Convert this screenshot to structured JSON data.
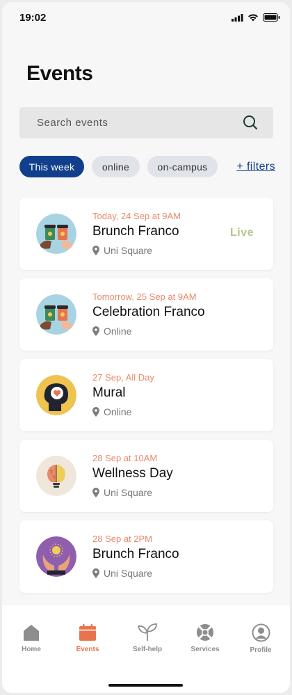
{
  "status": {
    "time": "19:02"
  },
  "page": {
    "title": "Events"
  },
  "search": {
    "placeholder": "Search events"
  },
  "filters": {
    "chips": [
      "This week",
      "online",
      "on-campus"
    ],
    "active": "This week",
    "more_label": "+ filters"
  },
  "events": [
    {
      "date": "Today, 24 Sep at 9AM",
      "name": "Brunch Franco",
      "location": "Uni Square",
      "badge": "Live",
      "icon": "coffee-cups-icon"
    },
    {
      "date": "Tomorrow, 25 Sep at 9AM",
      "name": "Celebration Franco",
      "location": "Online",
      "badge": "",
      "icon": "coffee-cups-icon"
    },
    {
      "date": "27 Sep, All Day",
      "name": "Mural",
      "location": "Online",
      "badge": "",
      "icon": "head-heart-icon"
    },
    {
      "date": "28 Sep at 10AM",
      "name": "Wellness Day",
      "location": "Uni Square",
      "badge": "",
      "icon": "brain-bulb-icon"
    },
    {
      "date": "28 Sep at 2PM",
      "name": "Brunch Franco",
      "location": "Uni Square",
      "badge": "",
      "icon": "hands-sun-icon"
    }
  ],
  "tabs": [
    {
      "label": "Home",
      "icon": "home-icon"
    },
    {
      "label": "Events",
      "icon": "calendar-icon"
    },
    {
      "label": "Self-help",
      "icon": "leaf-icon"
    },
    {
      "label": "Services",
      "icon": "lifebuoy-icon"
    },
    {
      "label": "Profile",
      "icon": "profile-icon"
    }
  ],
  "active_tab": "Events",
  "colors": {
    "accent": "#123f8c",
    "date": "#e8896a",
    "live": "#b3c58a",
    "active_tab": "#e8744e"
  }
}
